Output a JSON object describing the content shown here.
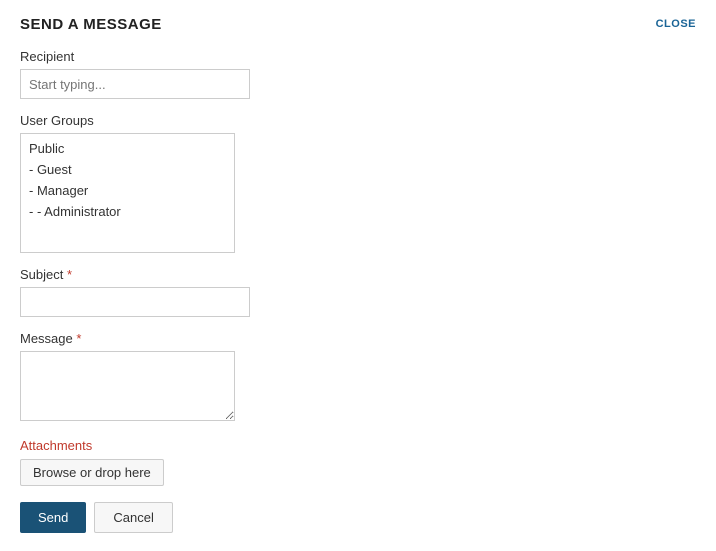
{
  "header": {
    "title": "SEND A MESSAGE",
    "close_label": "CLOSE"
  },
  "form": {
    "recipient": {
      "label": "Recipient",
      "placeholder": "Start typing..."
    },
    "user_groups": {
      "label": "User Groups",
      "items": [
        {
          "id": "public",
          "text": "Public"
        },
        {
          "id": "guest",
          "text": "- Guest"
        },
        {
          "id": "manager",
          "text": "- Manager"
        },
        {
          "id": "administrator",
          "text": "- - Administrator"
        }
      ]
    },
    "subject": {
      "label": "Subject",
      "required": true
    },
    "message": {
      "label": "Message",
      "required": true
    },
    "attachments": {
      "label": "Attachments",
      "browse_label": "Browse or drop here"
    },
    "buttons": {
      "send": "Send",
      "cancel": "Cancel"
    }
  }
}
